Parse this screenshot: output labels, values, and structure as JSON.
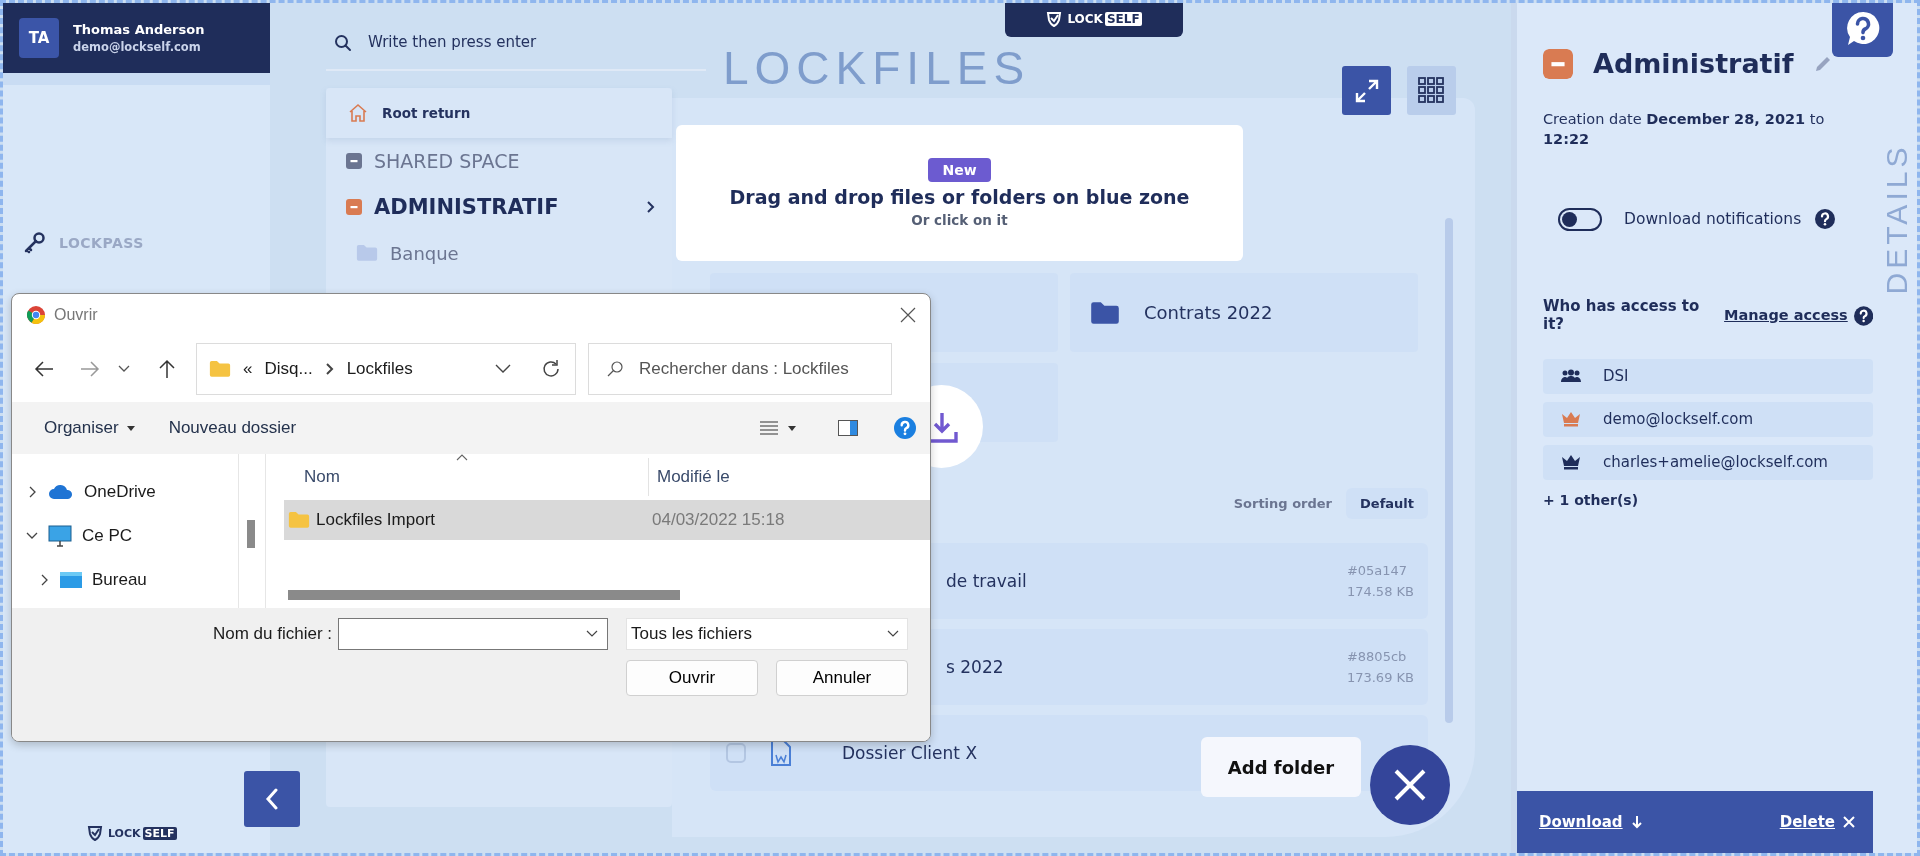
{
  "user": {
    "initials": "TA",
    "name": "Thomas Anderson",
    "email": "demo@lockself.com"
  },
  "sidebar": {
    "items": [
      {
        "label": "LOCKPASS",
        "selected": false
      }
    ]
  },
  "top_logo": {
    "left": "LOCK",
    "right": "SELF"
  },
  "bottom_logo": {
    "left": "LOCK",
    "right": "SELF"
  },
  "background_title": "LOCKFILES",
  "search": {
    "placeholder": "Write then press enter"
  },
  "tree": {
    "root": "Root return",
    "items": [
      {
        "label": "SHARED SPACE",
        "color": "#6b7591",
        "selected": false
      },
      {
        "label": "ADMINISTRATIF",
        "color": "#d97b52",
        "selected": true,
        "children": [
          {
            "label": "Banque",
            "selected": false
          }
        ]
      }
    ]
  },
  "dropzone": {
    "badge": "New",
    "title": "Drag and drop files or folders on blue zone",
    "subtitle": "Or click on it"
  },
  "folders": [
    {
      "kind": "covered"
    },
    {
      "kind": "folder",
      "label": "Contrats 2022"
    },
    {
      "kind": "covered"
    }
  ],
  "sorting": {
    "label": "Sorting order",
    "value": "Default"
  },
  "files": [
    {
      "kind": "partial",
      "name": "de travail",
      "hash": "#05a147",
      "size": "174.58 KB"
    },
    {
      "kind": "partial",
      "name": "s 2022",
      "hash": "#8805cb",
      "size": "173.69 KB"
    },
    {
      "kind": "full",
      "name": "Dossier Client X",
      "checked": false
    }
  ],
  "add_folder": "Add folder",
  "details": {
    "title": "Administratif",
    "color": "#d97b52",
    "creation": "Creation date **December 28, 2021** to **12:22**",
    "notifications": {
      "label": "Download notifications",
      "on": false
    },
    "access_title": "Who has access to it?",
    "manage": "Manage access",
    "access": [
      {
        "kind": "group",
        "label": "DSI"
      },
      {
        "kind": "owner",
        "label": "demo@lockself.com"
      },
      {
        "kind": "member",
        "label": "charles+amelie@lockself.com"
      }
    ],
    "others": "+ 1 other(s)",
    "watermark": "DETAILS"
  },
  "actions": {
    "download": "Download",
    "delete": "Delete"
  },
  "dialog": {
    "title": "Ouvrir",
    "overflow_mark": "«",
    "path": [
      "Disq...",
      "Lockfiles"
    ],
    "search_placeholder": "Rechercher dans : Lockfiles",
    "toolbar": [
      "Organiser",
      "Nouveau dossier"
    ],
    "nav": [
      {
        "label": "OneDrive",
        "kind": "cloud",
        "expanded": false
      },
      {
        "label": "Ce PC",
        "kind": "pc",
        "expanded": true,
        "children": [
          {
            "label": "Bureau",
            "kind": "desktop",
            "expanded": false
          }
        ]
      }
    ],
    "columns": [
      "Nom",
      "Modifié le"
    ],
    "rows": [
      {
        "name": "Lockfiles Import",
        "modified": "04/03/2022 15:18",
        "selected": true
      }
    ],
    "filename_label": "Nom du fichier :",
    "filetype": "Tous les fichiers",
    "buttons": [
      "Ouvrir",
      "Annuler"
    ]
  }
}
